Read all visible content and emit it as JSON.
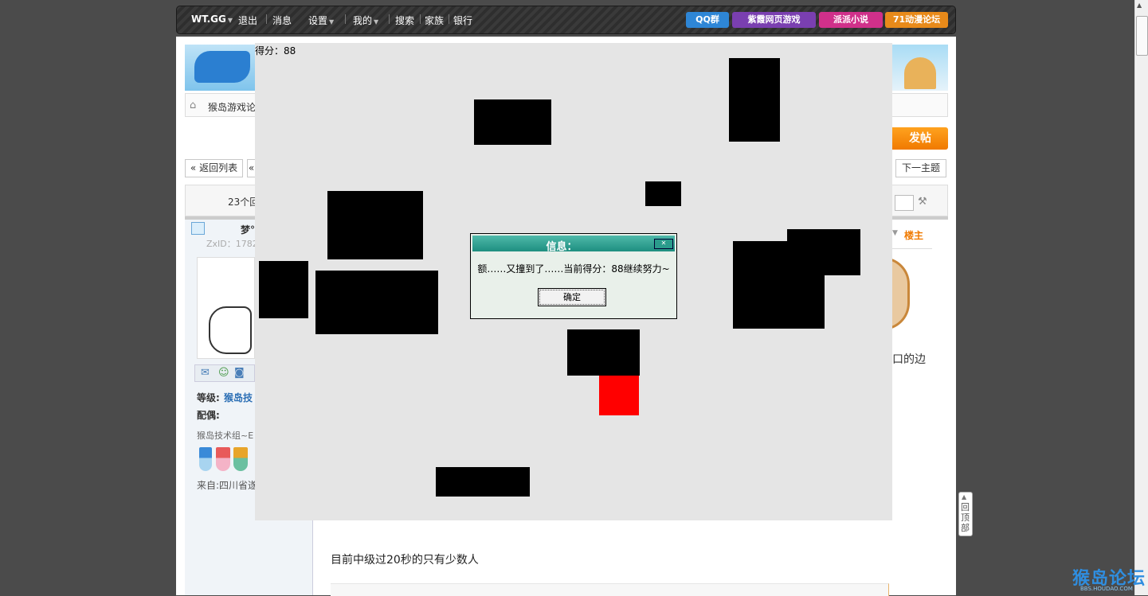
{
  "nav": {
    "brand": "WT.GG",
    "logout": "退出",
    "messages": "消息",
    "settings": "设置",
    "mine": "我的",
    "search": "搜索",
    "family": "家族",
    "bank": "银行"
  },
  "badges": {
    "qq": "QQ群",
    "game": "紫霞网页游戏",
    "novel": "派派小说",
    "comic": "71动漫论坛"
  },
  "breadcrumb": "猴岛游戏论",
  "post_button": "发帖",
  "back_to_list": "« 返回列表",
  "prev_arrow": "«",
  "next_topic": "下一主题",
  "reply_count": "23个回",
  "user": {
    "name": "梦°",
    "id": "ZxID：1782",
    "level_label": "等级:",
    "level_value": "猴岛技",
    "spouse_label": "配偶:",
    "group": "猴岛技术组~E",
    "from": "来自:四川省遂"
  },
  "louzhu": "楼主",
  "post_fragment": "口的边",
  "post_text": "目前中级过20秒的只有少数人",
  "back_to_top": "回顶部",
  "watermark": {
    "main": "猴岛论坛",
    "sub": "BBS.HOUDAO.COM"
  },
  "game": {
    "score_label": "得分：88"
  },
  "dialog": {
    "title": "信息：",
    "message": "额……又撞到了……当前得分：88继续努力~",
    "ok": "确定"
  }
}
